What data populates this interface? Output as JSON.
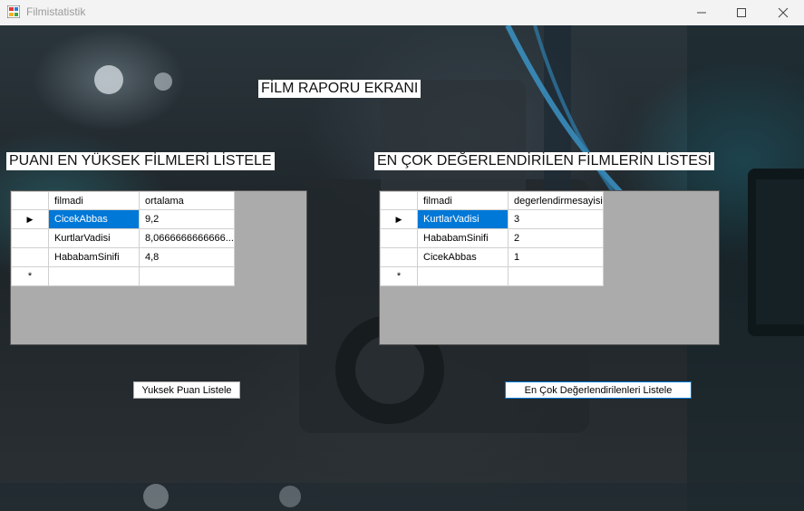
{
  "window": {
    "title": "Filmistatistik",
    "minimize_icon": "minimize-icon",
    "maximize_icon": "maximize-icon",
    "close_icon": "close-icon"
  },
  "labels": {
    "report_title": "FİLM RAPORU EKRANI",
    "top_rated_title": "PUANI EN YÜKSEK FİLMLERİ LİSTELE",
    "most_rated_title": "EN ÇOK DEĞERLENDİRİLEN FİLMLERİN LİSTESİ"
  },
  "grid_left": {
    "columns": [
      "filmadi",
      "ortalama"
    ],
    "rows": [
      [
        "CicekAbbas",
        "9,2"
      ],
      [
        "KurtlarVadisi",
        "8,0666666666666..."
      ],
      [
        "HababamSinifi",
        "4,8"
      ]
    ],
    "selected_row": 0
  },
  "grid_right": {
    "columns": [
      "filmadi",
      "degerlendirmesayisi"
    ],
    "rows": [
      [
        "KurtlarVadisi",
        "3"
      ],
      [
        "HababamSinifi",
        "2"
      ],
      [
        "CicekAbbas",
        "1"
      ]
    ],
    "selected_row": 0
  },
  "row_markers": {
    "current": "▶",
    "new": "*"
  },
  "buttons": {
    "top_rated": "Yuksek Puan Listele",
    "most_rated": "En Çok Değerlendirilenleri Listele"
  }
}
